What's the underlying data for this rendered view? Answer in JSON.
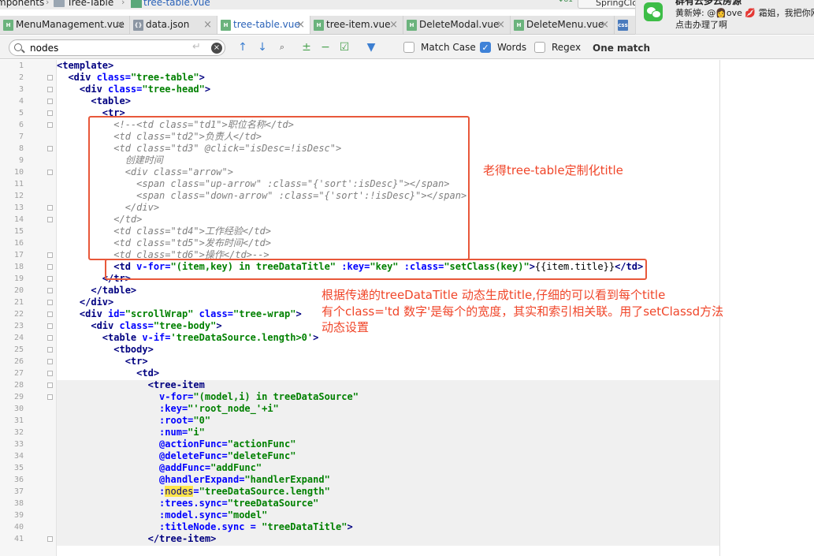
{
  "breadcrumb": {
    "items": [
      "mponents",
      "Tree-Table",
      "tree-table.vue"
    ],
    "spring_label": "SpringClo",
    "vcs_label": "81"
  },
  "tabs": [
    {
      "label": "MenuManagement.vue",
      "icon": "vue",
      "active": false
    },
    {
      "label": "data.json",
      "icon": "json",
      "active": false
    },
    {
      "label": "tree-table.vue",
      "icon": "vue",
      "active": true
    },
    {
      "label": "tree-item.vue",
      "icon": "vue",
      "active": false
    },
    {
      "label": "DeleteModal.vue",
      "icon": "vue",
      "active": false
    },
    {
      "label": "DeleteMenu.vue",
      "icon": "vue",
      "active": false
    },
    {
      "label": "css",
      "icon": "css",
      "active": false
    }
  ],
  "notification": {
    "app_icon": "wechat-icon",
    "title": "群有云多云房源",
    "line1": "黄新婷: @👩ove 💋 霜姐，我把你刚",
    "line2": "点击办理了啊"
  },
  "find": {
    "query": "nodes",
    "match_case_label": "Match Case",
    "match_case": false,
    "words_label": "Words",
    "words": true,
    "regex_label": "Regex",
    "regex": false,
    "result": "One match"
  },
  "line_numbers": [
    "1",
    "2",
    "3",
    "4",
    "5",
    "6",
    "7",
    "8",
    "9",
    "10",
    "11",
    "12",
    "13",
    "14",
    "15",
    "16",
    "17",
    "18",
    "19",
    "20",
    "21",
    "22",
    "23",
    "24",
    "25",
    "26",
    "27",
    "28",
    "29",
    "30",
    "31",
    "32",
    "33",
    "34",
    "35",
    "36",
    "37",
    "38",
    "39",
    "40",
    "41"
  ],
  "code_lines": [
    [
      [
        "t",
        "<template>"
      ]
    ],
    [
      [
        "p",
        "  "
      ],
      [
        "t",
        "<div "
      ],
      [
        "a",
        "class="
      ],
      [
        "s",
        "\"tree-table\""
      ],
      [
        "t",
        ">"
      ]
    ],
    [
      [
        "p",
        "    "
      ],
      [
        "t",
        "<div "
      ],
      [
        "a",
        "class="
      ],
      [
        "s",
        "\"tree-head\""
      ],
      [
        "t",
        ">"
      ]
    ],
    [
      [
        "p",
        "      "
      ],
      [
        "t",
        "<table>"
      ]
    ],
    [
      [
        "p",
        "        "
      ],
      [
        "t",
        "<tr>"
      ]
    ],
    [
      [
        "c",
        "          <!--<td class=\"td1\">职位名称</td>"
      ]
    ],
    [
      [
        "c",
        "          <td class=\"td2\">负责人</td>"
      ]
    ],
    [
      [
        "c",
        "          <td class=\"td3\" @click=\"isDesc=!isDesc\">"
      ]
    ],
    [
      [
        "c",
        "            创建时间"
      ]
    ],
    [
      [
        "c",
        "            <div class=\"arrow\">"
      ]
    ],
    [
      [
        "c",
        "              <span class=\"up-arrow\" :class=\"{'sort':isDesc}\"></span>"
      ]
    ],
    [
      [
        "c",
        "              <span class=\"down-arrow\" :class=\"{'sort':!isDesc}\"></span>"
      ]
    ],
    [
      [
        "c",
        "            </div>"
      ]
    ],
    [
      [
        "c",
        "          </td>"
      ]
    ],
    [
      [
        "c",
        "          <td class=\"td4\">工作经验</td>"
      ]
    ],
    [
      [
        "c",
        "          <td class=\"td5\">发布时间</td>"
      ]
    ],
    [
      [
        "c",
        "          <td class=\"td6\">操作</td>-->"
      ]
    ],
    [
      [
        "p",
        "          "
      ],
      [
        "t",
        "<td "
      ],
      [
        "a",
        "v-for="
      ],
      [
        "s",
        "\"(item,key) in treeDataTitle\""
      ],
      [
        "a",
        " :key="
      ],
      [
        "s",
        "\"key\""
      ],
      [
        "a",
        " :class="
      ],
      [
        "s",
        "\"setClass(key)\""
      ],
      [
        "t",
        ">"
      ],
      [
        "m",
        "{{item.title}}"
      ],
      [
        "t",
        "</td>"
      ]
    ],
    [
      [
        "p",
        "        "
      ],
      [
        "t",
        "</tr>"
      ]
    ],
    [
      [
        "p",
        "      "
      ],
      [
        "t",
        "</table>"
      ]
    ],
    [
      [
        "p",
        "    "
      ],
      [
        "t",
        "</div>"
      ]
    ],
    [
      [
        "p",
        "    "
      ],
      [
        "t",
        "<div "
      ],
      [
        "a",
        "id="
      ],
      [
        "s",
        "\"scrollWrap\""
      ],
      [
        "a",
        " class="
      ],
      [
        "s",
        "\"tree-wrap\""
      ],
      [
        "t",
        ">"
      ]
    ],
    [
      [
        "p",
        "      "
      ],
      [
        "t",
        "<div "
      ],
      [
        "a",
        "class="
      ],
      [
        "s",
        "\"tree-body\""
      ],
      [
        "t",
        ">"
      ]
    ],
    [
      [
        "p",
        "        "
      ],
      [
        "t",
        "<table "
      ],
      [
        "a",
        "v-if="
      ],
      [
        "s",
        "'treeDataSource.length>0'"
      ],
      [
        "t",
        ">"
      ]
    ],
    [
      [
        "p",
        "          "
      ],
      [
        "t",
        "<tbody>"
      ]
    ],
    [
      [
        "p",
        "            "
      ],
      [
        "t",
        "<tr>"
      ]
    ],
    [
      [
        "p",
        "              "
      ],
      [
        "t",
        "<td>"
      ]
    ],
    [
      [
        "p",
        "                "
      ],
      [
        "t",
        "<tree-item"
      ]
    ],
    [
      [
        "p",
        "                  "
      ],
      [
        "a",
        "v-for="
      ],
      [
        "s",
        "\"(model,i) in treeDataSource\""
      ]
    ],
    [
      [
        "p",
        "                  "
      ],
      [
        "a",
        ":key="
      ],
      [
        "s",
        "\"'root_node_'+i\""
      ]
    ],
    [
      [
        "p",
        "                  "
      ],
      [
        "a",
        ":root="
      ],
      [
        "s",
        "\"0\""
      ]
    ],
    [
      [
        "p",
        "                  "
      ],
      [
        "a",
        ":num="
      ],
      [
        "s",
        "\"i\""
      ]
    ],
    [
      [
        "p",
        "                  "
      ],
      [
        "a",
        "@actionFunc="
      ],
      [
        "s",
        "\"actionFunc\""
      ]
    ],
    [
      [
        "p",
        "                  "
      ],
      [
        "a",
        "@deleteFunc="
      ],
      [
        "s",
        "\"deleteFunc\""
      ]
    ],
    [
      [
        "p",
        "                  "
      ],
      [
        "a",
        "@addFunc="
      ],
      [
        "s",
        "\"addFunc\""
      ]
    ],
    [
      [
        "p",
        "                  "
      ],
      [
        "a",
        "@handlerExpand="
      ],
      [
        "s",
        "\"handlerExpand\""
      ]
    ],
    [
      [
        "p",
        "                  "
      ],
      [
        "a",
        ":"
      ],
      [
        "h",
        "nodes"
      ],
      [
        "a",
        "="
      ],
      [
        "s",
        "\"treeDataSource.length\""
      ]
    ],
    [
      [
        "p",
        "                  "
      ],
      [
        "a",
        ":trees.sync="
      ],
      [
        "s",
        "\"treeDataSource\""
      ]
    ],
    [
      [
        "p",
        "                  "
      ],
      [
        "a",
        ":model.sync="
      ],
      [
        "s",
        "\"model\""
      ]
    ],
    [
      [
        "p",
        "                  "
      ],
      [
        "a",
        ":titleNode.sync = "
      ],
      [
        "s",
        "\"treeDataTitle\""
      ],
      [
        "t",
        ">"
      ]
    ],
    [
      [
        "p",
        "                "
      ],
      [
        "t",
        "</tree-item>"
      ]
    ]
  ],
  "annotations": {
    "note1": "老得tree-table定制化title",
    "note2_line1": "根据传递的treeDataTitle 动态生成title,仔细的可以看到每个title",
    "note2_line2": "有个class='td 数字'是每个的宽度，其实和索引相关联。用了setClassd方法",
    "note2_line3": "动态设置"
  },
  "colors": {
    "annotation": "#f0462a",
    "tag": "#000080",
    "attribute": "#0000ff",
    "string": "#008000",
    "comment": "#808080",
    "search_hit": "#ffe54a"
  }
}
